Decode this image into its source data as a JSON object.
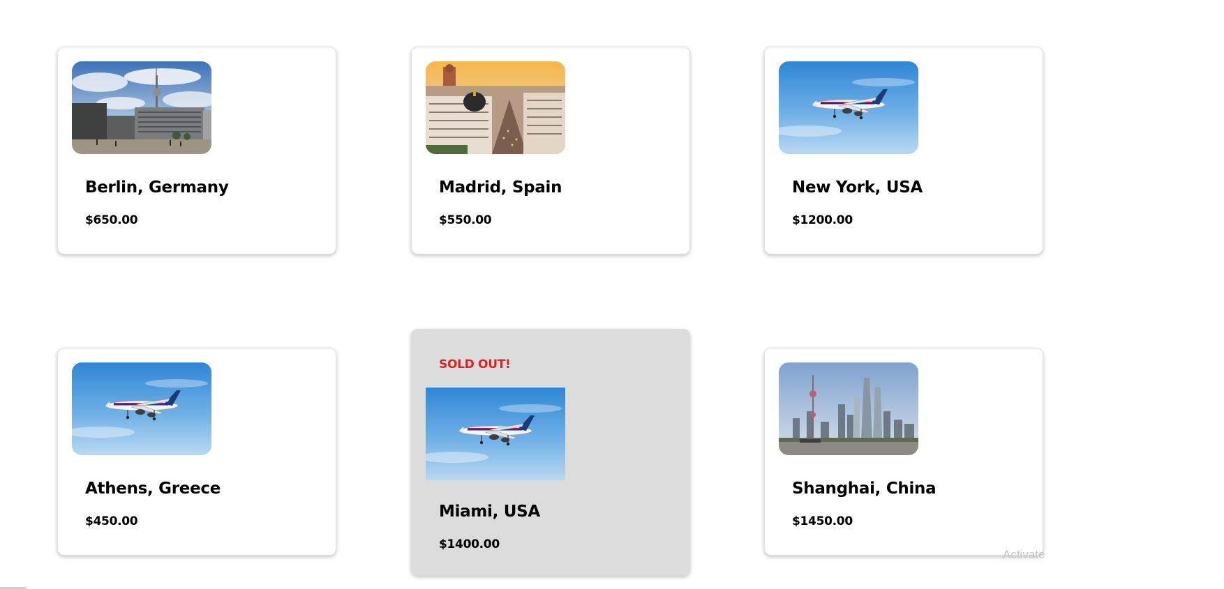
{
  "destinations": [
    {
      "city": "Berlin, Germany",
      "price": "$650.00",
      "image": "berlin-tv-tower-photo",
      "sold_out": false
    },
    {
      "city": "Madrid, Spain",
      "price": "$550.00",
      "image": "madrid-cityscape-photo",
      "sold_out": false
    },
    {
      "city": "New York, USA",
      "price": "$1200.00",
      "image": "airplane-sky-photo",
      "sold_out": false
    },
    {
      "city": "Athens, Greece",
      "price": "$450.00",
      "image": "airplane-sky-photo",
      "sold_out": false
    },
    {
      "city": "Miami, USA",
      "price": "$1400.00",
      "image": "airplane-sky-photo",
      "sold_out": true,
      "badge": "SOLD OUT!"
    },
    {
      "city": "Shanghai, China",
      "price": "$1450.00",
      "image": "shanghai-skyline-photo",
      "sold_out": false
    }
  ],
  "watermark": "Activate",
  "colors": {
    "sold_out_badge": "#e02020",
    "sold_out_card_bg": "#dcdcdc",
    "card_bg": "#ffffff"
  }
}
